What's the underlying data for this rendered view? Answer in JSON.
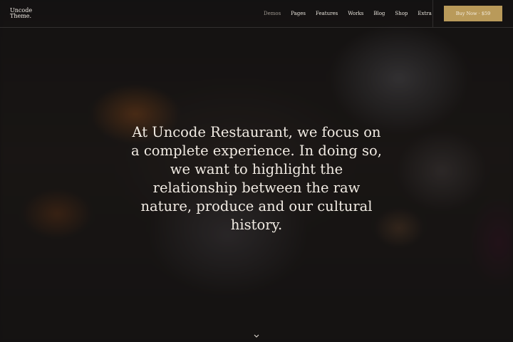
{
  "header": {
    "logo_lines": "Uncode\nTheme.",
    "nav": [
      {
        "label": "Demos",
        "active": true
      },
      {
        "label": "Pages"
      },
      {
        "label": "Features"
      },
      {
        "label": "Works"
      },
      {
        "label": "Blog"
      },
      {
        "label": "Shop"
      },
      {
        "label": "Extra"
      }
    ],
    "buy_label": "Buy Now · $59",
    "accent_color": "#b99a5a"
  },
  "hero": {
    "text": "At Uncode Restaurant, we focus on a complete experience. In doing so, we want to highlight the relationship between the raw nature, produce and our cultural history."
  },
  "icons": {
    "scroll": "chevron-down-icon"
  }
}
